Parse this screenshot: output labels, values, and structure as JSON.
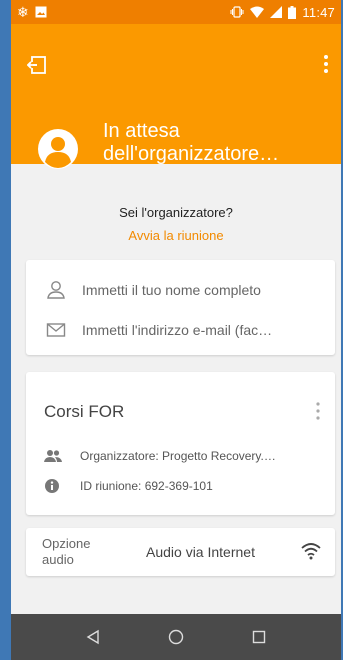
{
  "status_bar": {
    "time": "11:47",
    "icons": [
      "snowflake-icon",
      "image-icon",
      "vibrate-icon",
      "wifi-icon",
      "signal-icon",
      "battery-icon"
    ]
  },
  "header": {
    "title_line1": "In attesa",
    "title_line2": "dell'organizzatore…",
    "icons": [
      "exit-icon",
      "more-vert-icon",
      "avatar-icon"
    ],
    "bg_color": "#fb9900"
  },
  "host_prompt": {
    "question": "Sei l'organizzatore?",
    "link": "Avvia la riunione",
    "link_color": "#f28a00"
  },
  "attendee_form": {
    "name_placeholder": "Immetti il tuo nome completo",
    "email_placeholder": "Immetti l'indirizzo e-mail (fac…"
  },
  "meeting": {
    "title": "Corsi FOR",
    "organizer": "Organizzatore: Progetto Recovery.…",
    "meeting_id": "ID riunione: 692-369-101"
  },
  "audio": {
    "label": "Opzione audio",
    "value": "Audio via Internet"
  },
  "nav_bar": {
    "buttons": [
      "back-icon",
      "home-icon",
      "recents-icon"
    ]
  }
}
